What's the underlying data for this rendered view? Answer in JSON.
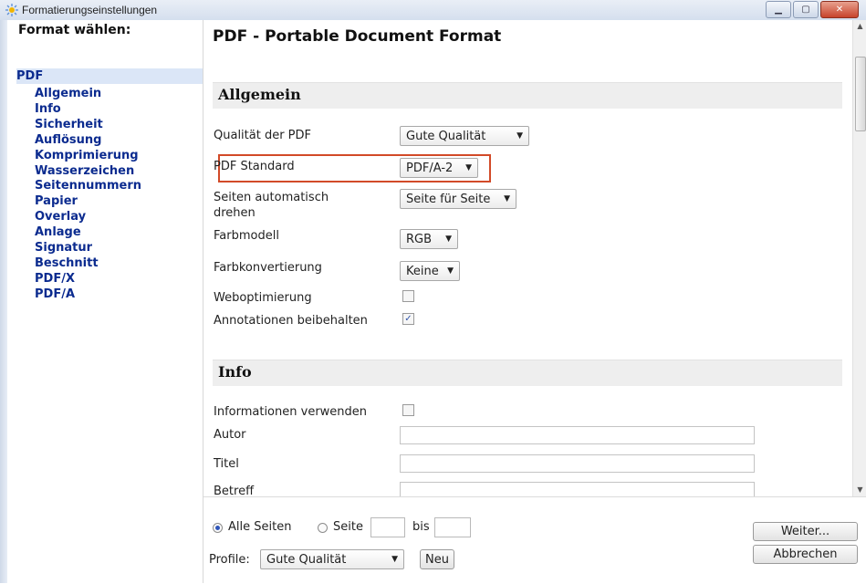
{
  "window": {
    "title": "Formatierungseinstellungen"
  },
  "sidebar": {
    "heading": "Format wählen:",
    "selected": "PDF",
    "items": [
      "Allgemein",
      "Info",
      "Sicherheit",
      "Auflösung",
      "Komprimierung",
      "Wasserzeichen",
      "Seitennummern",
      "Papier",
      "Overlay",
      "Anlage",
      "Signatur",
      "Beschnitt",
      "PDF/X",
      "PDF/A"
    ]
  },
  "main": {
    "title": "PDF - Portable Document Format",
    "allgemein": {
      "heading": "Allgemein",
      "quality_label": "Qualität der PDF",
      "quality_value": "Gute Qualität",
      "standard_label": "PDF Standard",
      "standard_value": "PDF/A-2",
      "rotate_label": "Seiten automatisch drehen",
      "rotate_value": "Seite für Seite",
      "color_model_label": "Farbmodell",
      "color_model_value": "RGB",
      "color_conv_label": "Farbkonvertierung",
      "color_conv_value": "Keine",
      "weboptim_label": "Weboptimierung",
      "weboptim_checked": false,
      "annot_label": "Annotationen beibehalten",
      "annot_checked": true
    },
    "info": {
      "heading": "Info",
      "use_info_label": "Informationen verwenden",
      "use_info_checked": false,
      "author_label": "Autor",
      "author_value": "",
      "title_label": "Titel",
      "title_value": "",
      "subject_label": "Betreff",
      "subject_value": ""
    }
  },
  "bottom": {
    "all_pages_label": "Alle Seiten",
    "page_label": "Seite",
    "page_from": "",
    "bis_label": "bis",
    "page_to": "",
    "profile_label": "Profile:",
    "profile_value": "Gute Qualität",
    "new_button": "Neu",
    "next_button": "Weiter...",
    "cancel_button": "Abbrechen"
  },
  "colors": {
    "highlight": "#d24a28",
    "nav_text": "#0b2b8f",
    "nav_selected_bg": "#dbe6f7"
  }
}
